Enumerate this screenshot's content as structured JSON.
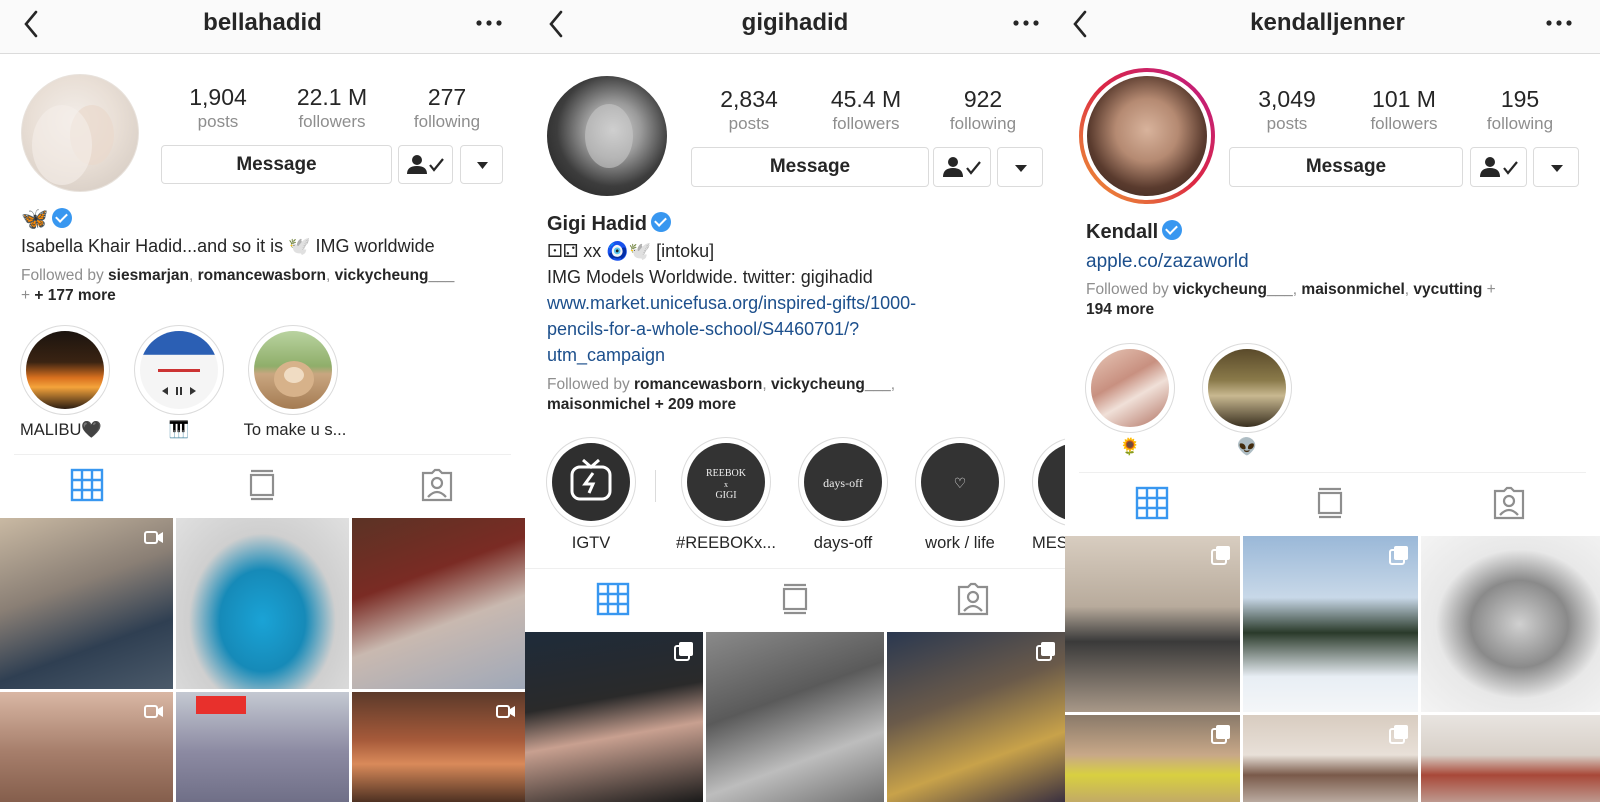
{
  "profiles": [
    {
      "username": "bellahadid",
      "stats": [
        {
          "value": "1,904",
          "label": "posts"
        },
        {
          "value": "22.1 M",
          "label": "followers"
        },
        {
          "value": "277",
          "label": "following"
        }
      ],
      "message_label": "Message",
      "name": "🦋",
      "verified": true,
      "bio_lines": [
        "Isabella Khair Hadid...and so it is 🕊️ IMG worldwide"
      ],
      "link": "",
      "followed_by": {
        "prefix": "Followed by ",
        "names": [
          "siesmarjan",
          "romancewasborn",
          "vickycheung___"
        ],
        "more": "+ 177 more"
      },
      "highlights": [
        {
          "label": "MALIBU🖤"
        },
        {
          "label": "🎹"
        },
        {
          "label": "To make u s..."
        }
      ]
    },
    {
      "username": "gigihadid",
      "stats": [
        {
          "value": "2,834",
          "label": "posts"
        },
        {
          "value": "45.4 M",
          "label": "followers"
        },
        {
          "value": "922",
          "label": "following"
        }
      ],
      "message_label": "Message",
      "name": "Gigi Hadid",
      "verified": true,
      "bio_lines": [
        "⚀⚁ xx 🧿🕊️ [intoku]",
        "IMG Models Worldwide. twitter: gigihadid"
      ],
      "link_lines": [
        "www.market.unicefusa.org/inspired-gifts/1000-",
        "pencils-for-a-whole-school/S4460701/?",
        "utm_campaign"
      ],
      "followed_by": {
        "prefix": "Followed by ",
        "names": [
          "romancewasborn",
          "vickycheung___",
          "maisonmichel"
        ],
        "more": "+ 209 more"
      },
      "highlights": [
        {
          "label": "IGTV"
        },
        {
          "label": "#REEBOKx...",
          "cover_text": "REEBOK x GIGI"
        },
        {
          "label": "days-off",
          "cover_text": "days-off"
        },
        {
          "label": "work / life",
          "cover_text": "♡"
        },
        {
          "label": "MES"
        }
      ]
    },
    {
      "username": "kendalljenner",
      "stats": [
        {
          "value": "3,049",
          "label": "posts"
        },
        {
          "value": "101 M",
          "label": "followers"
        },
        {
          "value": "195",
          "label": "following"
        }
      ],
      "message_label": "Message",
      "name": "Kendall",
      "verified": true,
      "link": "apple.co/zazaworld",
      "followed_by": {
        "prefix": "Followed by ",
        "names": [
          "vickycheung___",
          "maisonmichel",
          "vycutting"
        ],
        "more": "194 more"
      },
      "highlights": [
        {
          "label": "🌻"
        },
        {
          "label": "👽"
        }
      ]
    }
  ],
  "icons": {
    "back": "chevron-left-icon",
    "more": "ellipsis-icon",
    "follow": "person-check-icon",
    "dropdown": "caret-down-icon",
    "grid": "grid-icon",
    "feed": "feed-icon",
    "tagged": "tagged-icon"
  },
  "colors": {
    "link": "#1c4f8c",
    "active_tab": "#3897f0",
    "verified": "#3897f0",
    "muted": "#8e8e8e"
  }
}
